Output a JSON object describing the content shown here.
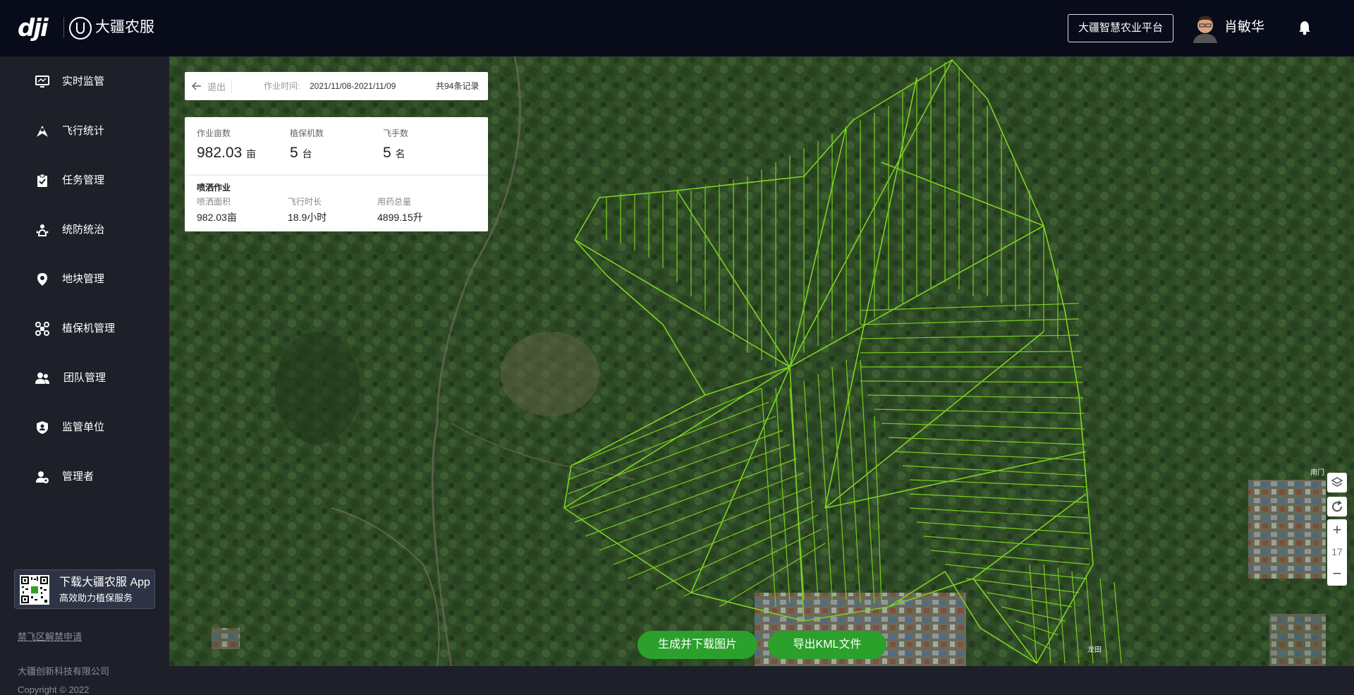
{
  "header": {
    "logo": "dji",
    "brand": "大疆农服",
    "platform_button": "大疆智慧农业平台",
    "user_name": "肖敏华",
    "bell_icon": "bell-icon"
  },
  "sidebar": {
    "items": [
      {
        "label": "实时监管",
        "icon": "monitor-icon"
      },
      {
        "label": "飞行统计",
        "icon": "flight-stat-icon"
      },
      {
        "label": "任务管理",
        "icon": "clipboard-icon"
      },
      {
        "label": "统防统治",
        "icon": "pest-control-icon"
      },
      {
        "label": "地块管理",
        "icon": "location-pin-icon"
      },
      {
        "label": "植保机管理",
        "icon": "drone-icon"
      },
      {
        "label": "团队管理",
        "icon": "team-icon"
      },
      {
        "label": "监管单位",
        "icon": "shield-icon"
      },
      {
        "label": "管理者",
        "icon": "admin-icon"
      }
    ],
    "app_card": {
      "title": "下载大疆农服 App",
      "subtitle": "高效助力植保服务"
    },
    "nofly_link": "禁飞区解禁申请",
    "company": "大疆创新科技有限公司",
    "copyright": "Copyright © 2022"
  },
  "info_bar": {
    "back_label": "退出",
    "time_label": "作业时间:",
    "time_value": "2021/11/08-2021/11/09",
    "records": "共94条记录"
  },
  "stats": {
    "area_label": "作业亩数",
    "area_value": "982.03",
    "area_unit": "亩",
    "drones_label": "植保机数",
    "drones_value": "5",
    "drones_unit": "台",
    "pilots_label": "飞手数",
    "pilots_value": "5",
    "pilots_unit": "名",
    "spray_title": "喷洒作业",
    "spray_area_label": "喷洒面积",
    "spray_area_value": "982.03亩",
    "flight_time_label": "飞行时长",
    "flight_time_value": "18.9小时",
    "chem_label": "用药总量",
    "chem_value": "4899.15升"
  },
  "map": {
    "zoom_level": "17",
    "labels": [
      "南门",
      "龙田"
    ],
    "track_color": "#7ed321"
  },
  "actions": {
    "generate_image": "生成并下载图片",
    "export_kml": "导出KML文件"
  }
}
